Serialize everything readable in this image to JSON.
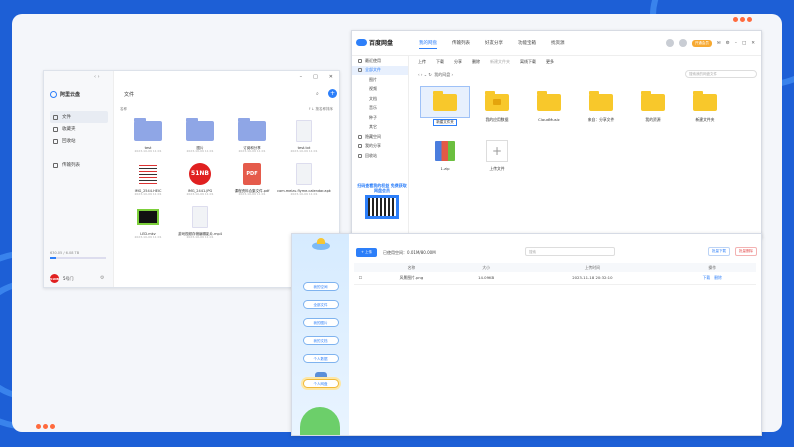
{
  "winA": {
    "title": "文件",
    "app": "阿里云盘",
    "sort": "名称",
    "view": "↑↓ 按名称排序",
    "nav": [
      {
        "label": "文件",
        "icon": "file-icon",
        "on": true
      },
      {
        "label": "收藏夹",
        "icon": "star-icon",
        "on": false
      },
      {
        "label": "回收站",
        "icon": "trash-icon",
        "on": false
      },
      {
        "label": "传输列表",
        "icon": "transfer-icon",
        "on": false
      }
    ],
    "quota": "630.05 / 6.08 TB",
    "quota_pct": 0.1,
    "user": "5号门",
    "user_avatar": "51NB",
    "files": [
      {
        "kind": "pfold",
        "name": "test",
        "date": "2023-10-09 11:01"
      },
      {
        "kind": "pfold",
        "name": "图片",
        "date": "2023-10-09 11:01"
      },
      {
        "kind": "pfold",
        "name": "订阅和分享",
        "date": "2023-10-09 11:01"
      },
      {
        "kind": "pdoc",
        "name": "test.txt",
        "date": "2023-10-09 11:01"
      },
      {
        "kind": "ph",
        "name": "IMG_2544.HEIC",
        "date": "2023-10-09 11:01"
      },
      {
        "kind": "b51",
        "name": "IMG_2441.JPG",
        "date": "2023-10-09 11:01",
        "badge": "51NB"
      },
      {
        "kind": "pdf",
        "name": "课程资料合集文件.pdf",
        "date": "2023-10-09 11:01",
        "badge": "PDF"
      },
      {
        "kind": "pdoc",
        "name": "com.meizu.flyme.calendar.apk",
        "date": "2023-10-09 11:01"
      },
      {
        "kind": "led",
        "name": "LED.mkv",
        "date": "2023-10-09 11:01"
      },
      {
        "kind": "pdoc",
        "name": "游戏视频存储编辑影片.mp4",
        "date": "2023-10-09 11:01"
      }
    ]
  },
  "winB": {
    "app": "百度网盘",
    "tabs": [
      "我的网盘",
      "传输列表",
      "好友分享",
      "功能宝箱",
      "找资源"
    ],
    "vip": "开通会员",
    "side": [
      {
        "label": "最近使用",
        "sub": false,
        "on": false
      },
      {
        "label": "全部文件",
        "sub": false,
        "on": true
      },
      {
        "label": "图片",
        "sub": true,
        "on": false
      },
      {
        "label": "视频",
        "sub": true,
        "on": false
      },
      {
        "label": "文档",
        "sub": true,
        "on": false
      },
      {
        "label": "音乐",
        "sub": true,
        "on": false
      },
      {
        "label": "种子",
        "sub": true,
        "on": false
      },
      {
        "label": "其它",
        "sub": true,
        "on": false
      },
      {
        "label": "隐藏空间",
        "sub": false,
        "on": false
      },
      {
        "label": "我的分享",
        "sub": false,
        "on": false
      },
      {
        "label": "回收站",
        "sub": false,
        "on": false
      }
    ],
    "promo": "扫码查看我的权益 免费获取网盘会员",
    "toolbar": [
      "上传",
      "下载",
      "分享",
      "删除",
      "新建文件夹",
      "离线下载",
      "更多"
    ],
    "path": "我的网盘",
    "search": "搜索我的网盘文件",
    "files": [
      {
        "kind": "yfold",
        "name": "新建文件夹",
        "sel": true
      },
      {
        "kind": "yfold ico",
        "name": "我的应用数据",
        "sel": false
      },
      {
        "kind": "yfold",
        "name": "CloudMusic",
        "sel": false
      },
      {
        "kind": "yfold",
        "name": "来自：分享文件",
        "sel": false
      },
      {
        "kind": "yfold",
        "name": "我的资源",
        "sel": false
      },
      {
        "kind": "yfold",
        "name": "新建文件夹",
        "sel": false
      },
      {
        "kind": "rar",
        "name": "1.zip",
        "sel": false
      },
      {
        "kind": "upl",
        "name": "上传文件",
        "sel": false
      }
    ]
  },
  "winC": {
    "side": [
      "我的空间",
      "全部文件",
      "我的图片",
      "我的文档",
      "个人数据"
    ],
    "active": "个人网盘",
    "upload": "上传",
    "used": "已使用空间：0.01M/80.00M",
    "search": "搜索",
    "actions": [
      "批量下载",
      "批量删除"
    ],
    "cols": [
      "",
      "名称",
      "大小",
      "上传时间",
      "操作"
    ],
    "rows": [
      {
        "name": "风景图片.png",
        "size": "14.09KB",
        "time": "2023-11-18 20:32:10",
        "ops": [
          "下载",
          "删除"
        ]
      }
    ]
  }
}
